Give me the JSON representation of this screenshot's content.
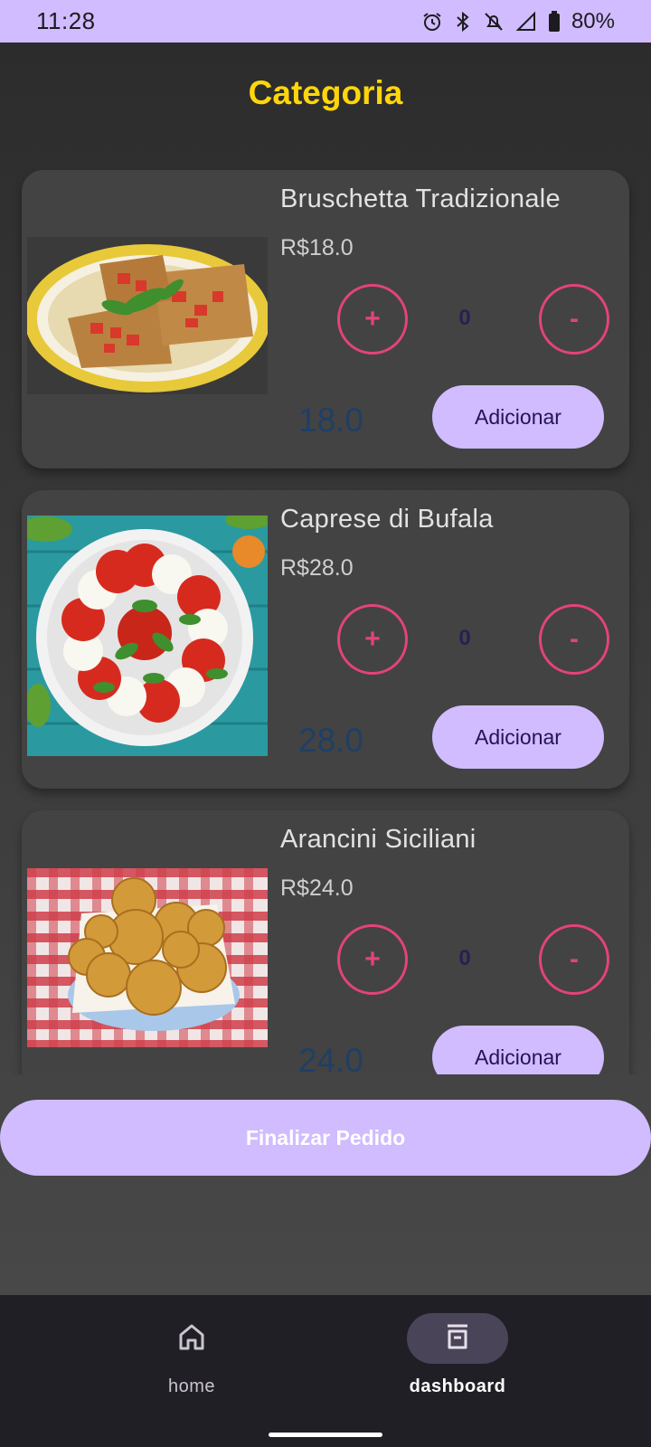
{
  "status_bar": {
    "time": "11:28",
    "battery": "80%",
    "icons": [
      "alarm-icon",
      "bluetooth-icon",
      "mute-icon",
      "signal-icon",
      "battery-icon"
    ]
  },
  "header": {
    "title": "Categoria"
  },
  "products": [
    {
      "name": "Bruschetta Tradizionale",
      "price": "R$18.0",
      "quantity": "0",
      "total": "18.0",
      "plus": "+",
      "minus": "-",
      "add_label": "Adicionar"
    },
    {
      "name": "Caprese di Bufala",
      "price": "R$28.0",
      "quantity": "0",
      "total": "28.0",
      "plus": "+",
      "minus": "-",
      "add_label": "Adicionar"
    },
    {
      "name": "Arancini Siciliani",
      "price": "R$24.0",
      "quantity": "0",
      "total": "24.0",
      "plus": "+",
      "minus": "-",
      "add_label": "Adicionar"
    }
  ],
  "finalize": {
    "label": "Finalizar Pedido"
  },
  "bottom_nav": {
    "items": [
      {
        "label": "home",
        "icon": "home-icon"
      },
      {
        "label": "dashboard",
        "icon": "dashboard-icon"
      }
    ]
  },
  "colors": {
    "accent": "#d0bcff",
    "title": "#ffd60a",
    "qty_button": "#e4437a",
    "card": "#434343"
  }
}
